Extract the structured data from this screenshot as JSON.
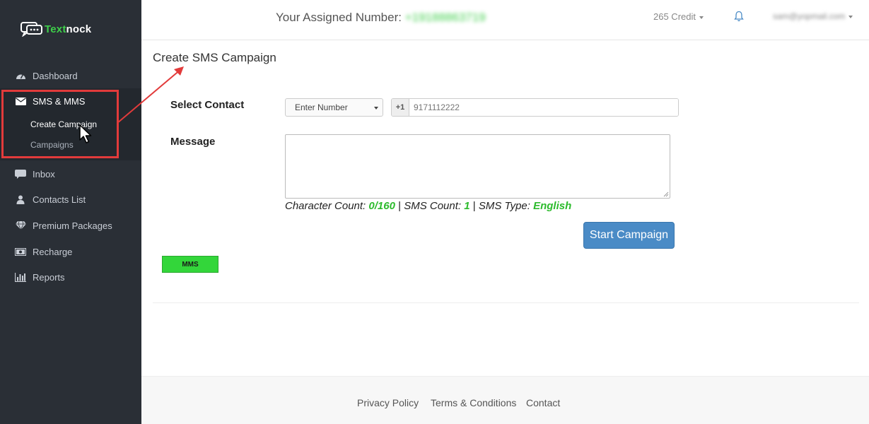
{
  "brand": {
    "name_part1": "Text",
    "name_part2": "nock"
  },
  "sidebar": {
    "items": [
      {
        "label": "Dashboard",
        "icon": "dashboard-icon"
      },
      {
        "label": "SMS & MMS",
        "icon": "envelope-icon"
      },
      {
        "label": "Inbox",
        "icon": "chat-icon"
      },
      {
        "label": "Contacts List",
        "icon": "user-icon"
      },
      {
        "label": "Premium Packages",
        "icon": "diamond-icon"
      },
      {
        "label": "Recharge",
        "icon": "money-icon"
      },
      {
        "label": "Reports",
        "icon": "bar-chart-icon"
      }
    ],
    "sub_items": [
      {
        "label": "Create Campaign"
      },
      {
        "label": "Campaigns"
      }
    ]
  },
  "header": {
    "assigned_label": "Your Assigned Number:",
    "assigned_number": "+19188863719",
    "credit": "265 Credit",
    "user_email": "sam@yopmail.com"
  },
  "main": {
    "title": "Create SMS Campaign",
    "select_contact_label": "Select Contact",
    "contact_type_selected": "Enter Number",
    "country_prefix": "+1",
    "phone_placeholder": "9171112222",
    "message_label": "Message",
    "counts": {
      "char_label": "Character Count:",
      "char_value": "0/160",
      "sms_label": "SMS Count:",
      "sms_value": "1",
      "type_label": "SMS Type:",
      "type_value": "English",
      "separator": "|"
    },
    "start_button": "Start Campaign",
    "mms_button": "MMS"
  },
  "footer": {
    "links": [
      "Privacy Policy",
      "Terms & Conditions",
      "Contact"
    ]
  },
  "colors": {
    "sidebar_bg": "#2a2f36",
    "accent_green": "#3ecf4a",
    "primary_blue": "#4a8bc6",
    "highlight_red": "#e23b3b"
  }
}
